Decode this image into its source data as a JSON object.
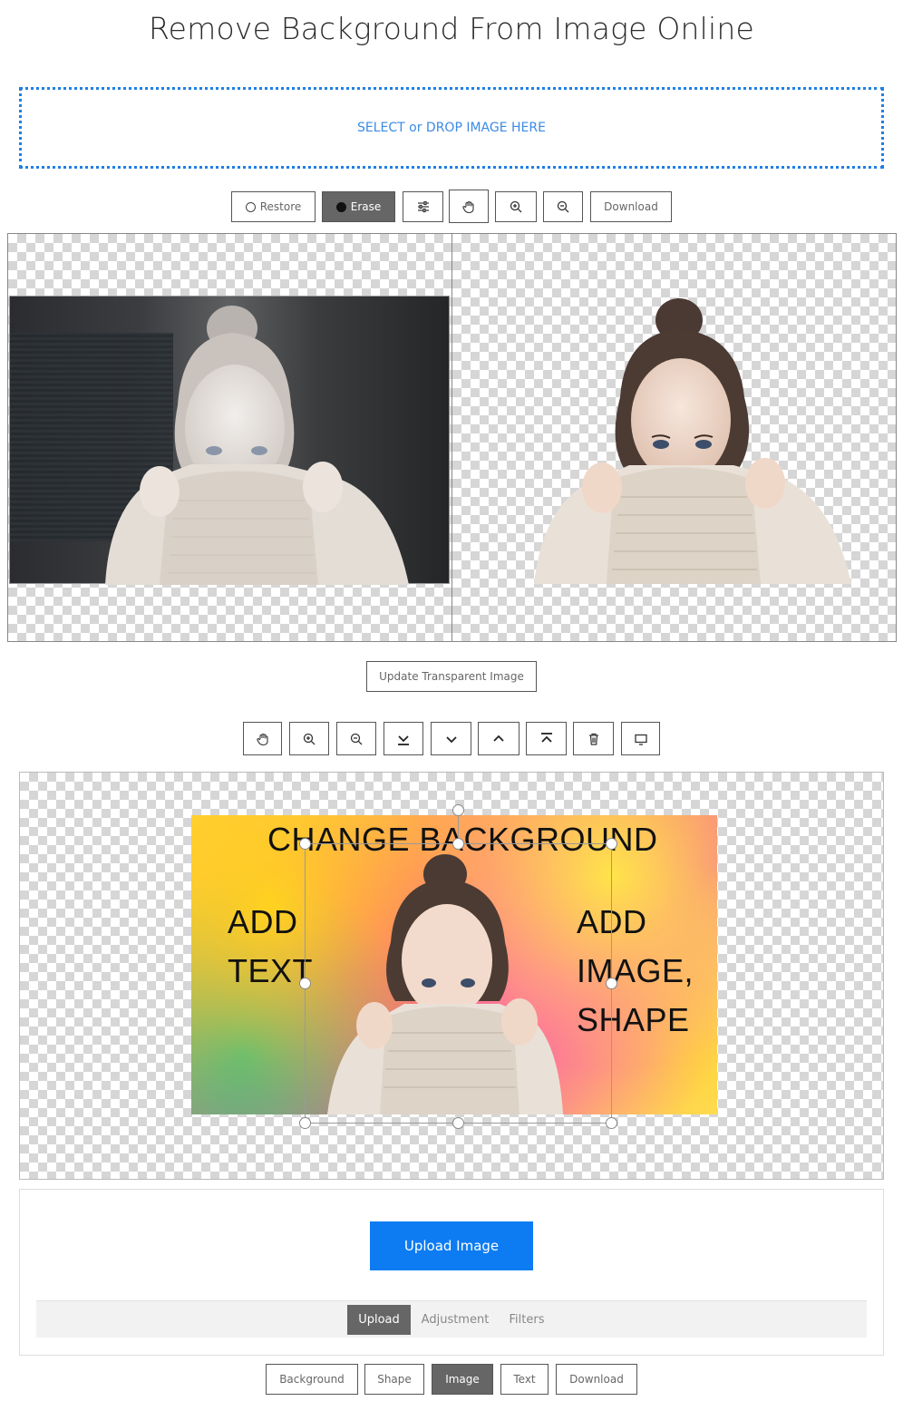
{
  "page": {
    "title": "Remove Background From Image Online"
  },
  "dropzone": {
    "label": "SELECT or DROP IMAGE HERE"
  },
  "eraser_toolbar": {
    "restore_label": "Restore",
    "erase_label": "Erase",
    "download_label": "Download",
    "tools": [
      "settings-sliders-icon",
      "hand-icon",
      "zoom-in-icon",
      "zoom-out-icon"
    ]
  },
  "update_button": {
    "label": "Update Transparent Image"
  },
  "editor_toolbar": {
    "tools": [
      "hand-icon",
      "zoom-in-icon",
      "zoom-out-icon",
      "send-to-back-icon",
      "send-backward-icon",
      "bring-forward-icon",
      "bring-to-front-icon",
      "trash-icon",
      "monitor-icon"
    ]
  },
  "collage": {
    "headline": "CHANGE BACKGROUND",
    "left_line1": "ADD",
    "left_line2": "TEXT",
    "right_line1": "ADD",
    "right_line2": "IMAGE,",
    "right_line3": "SHAPE"
  },
  "upload_panel": {
    "upload_label": "Upload Image",
    "tabs": [
      "Upload",
      "Adjustment",
      "Filters"
    ],
    "active_tab": "Upload"
  },
  "bottom_toolbar": {
    "buttons": [
      "Background",
      "Shape",
      "Image",
      "Text",
      "Download"
    ],
    "active": "Image"
  },
  "colors": {
    "accent_blue": "#0d7cf2",
    "dropzone_border": "#1f7fe6",
    "active_button": "#666666"
  }
}
